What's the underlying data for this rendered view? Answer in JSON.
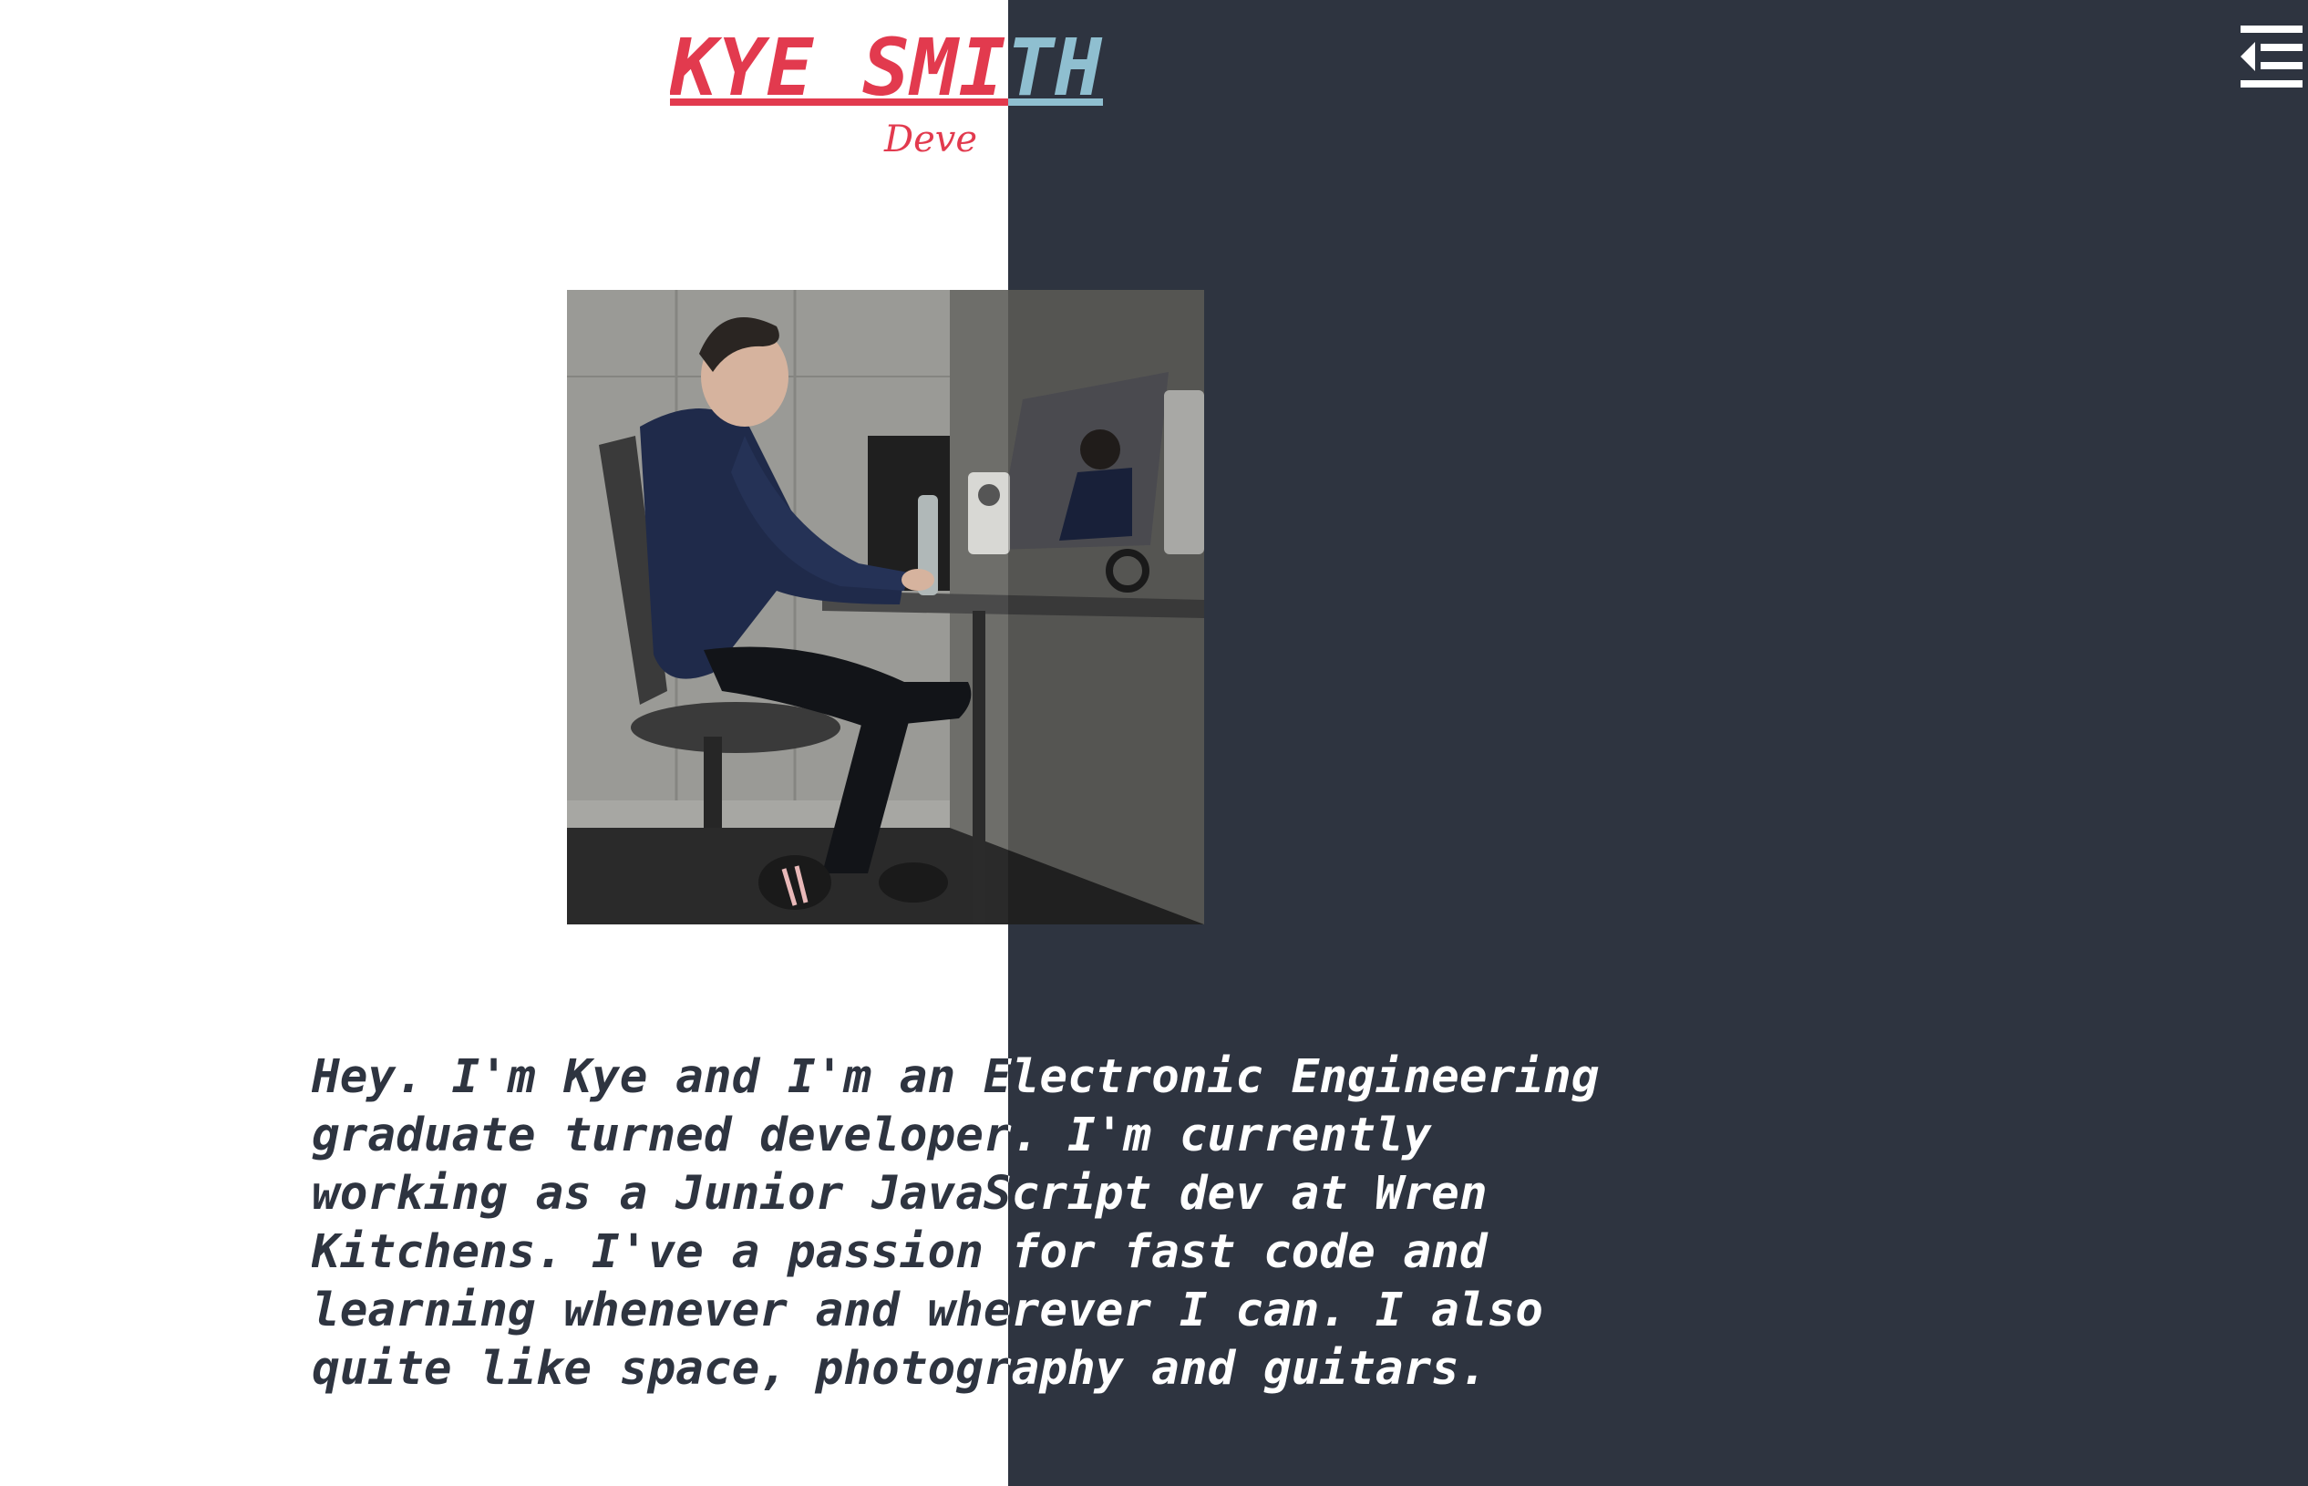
{
  "header": {
    "name": "KYE SMITH",
    "tagline": "Deve"
  },
  "menu": {
    "icon": "menu-collapse-icon"
  },
  "profile_photo": {
    "description_icon": "profile-photo"
  },
  "bio": {
    "text": "Hey. I'm Kye and I'm an Electronic Engineering\ngraduate turned developer. I'm currently\nworking as a Junior JavaScript dev at Wren\nKitchens. I've a passion for fast code and\nlearning whenever and wherever I can. I also\nquite like space, photography and guitars."
  },
  "colors": {
    "accent_red": "#e23a4e",
    "accent_blue": "#8fbfd0",
    "dark_panel": "#2e3440",
    "background": "#ffffff"
  }
}
